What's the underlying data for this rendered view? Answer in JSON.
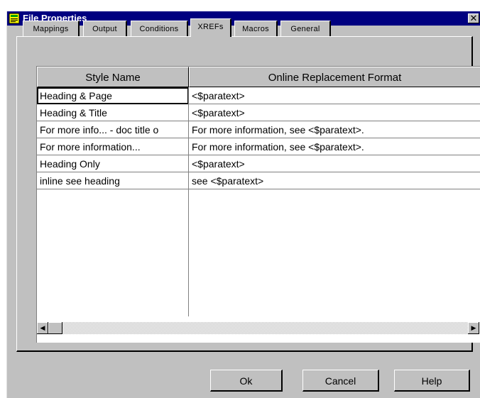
{
  "window": {
    "title": "File Properties",
    "close_glyph": "✕"
  },
  "tabs": [
    {
      "label": "Mappings"
    },
    {
      "label": "Output"
    },
    {
      "label": "Conditions"
    },
    {
      "label": "XREFs",
      "active": true
    },
    {
      "label": "Macros"
    },
    {
      "label": "General"
    }
  ],
  "grid": {
    "columns": [
      "Style Name",
      "Online Replacement Format"
    ],
    "rows": [
      [
        "Heading & Page",
        "<$paratext>"
      ],
      [
        "Heading & Title",
        "<$paratext>"
      ],
      [
        "For more info... - doc title o",
        "For more information, see <$paratext>."
      ],
      [
        "For more information...",
        "For more information, see <$paratext>."
      ],
      [
        "Heading Only",
        "<$paratext>"
      ],
      [
        "inline see heading",
        "see <$paratext>"
      ]
    ]
  },
  "buttons": {
    "ok": "Ok",
    "cancel": "Cancel",
    "help": "Help"
  },
  "colors": {
    "titlebar": "#000080",
    "face": "#c0c0c0"
  }
}
